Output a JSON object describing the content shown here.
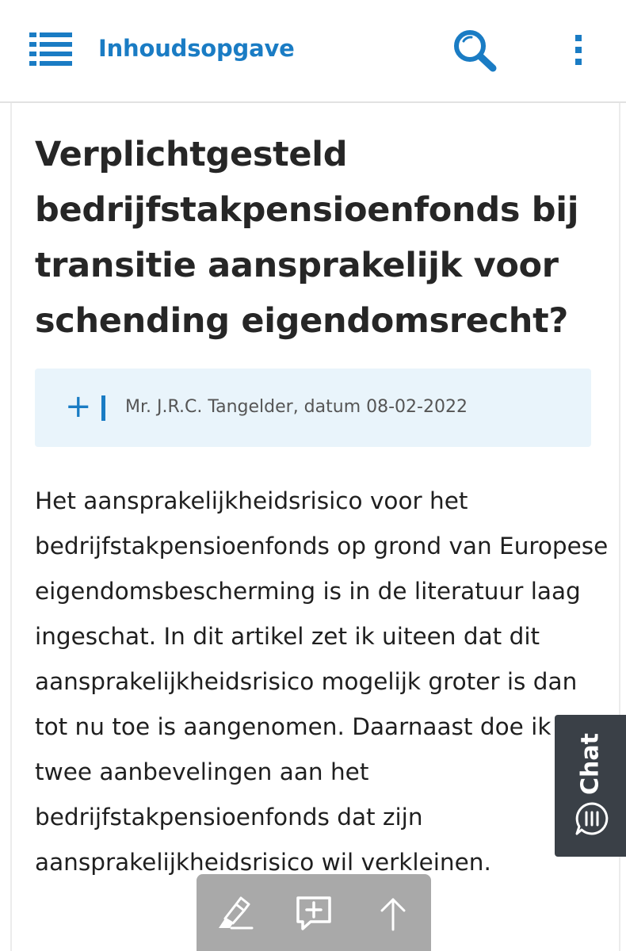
{
  "header": {
    "title": "Inhoudsopgave",
    "menu_icon": "hamburger-menu-icon",
    "search_icon": "search-icon",
    "more_icon": "more-vertical-icon",
    "accent_color": "#1a7cc4"
  },
  "article": {
    "title": "Verplichtgesteld bedrijfstakpensioenfonds bij transitie aansprakelijk voor schending eigendomsrecht?",
    "author_line": "Mr. J.R.C. Tangelder, datum 08-02-2022",
    "expand_symbol": "+",
    "intro": "Het aansprakelijkheidsrisico voor het bedrijfstakpensioenfonds op grond van Europese eigendomsbescherming is in de literatuur laag ingeschat. In dit artikel zet ik uiteen dat dit aansprakelijkheidsrisico mogelijk groter is dan tot nu toe is aangenomen. Daarnaast doe ik twee aanbevelingen aan het bedrijfstakpensioenfonds dat zijn aansprakelijkheidsrisico wil verkleinen."
  },
  "chat": {
    "label": "Chat",
    "icon": "chat-bubble-icon"
  },
  "toolbar": {
    "tools": [
      "highlighter-icon",
      "add-comment-icon",
      "arrow-up-icon"
    ]
  }
}
